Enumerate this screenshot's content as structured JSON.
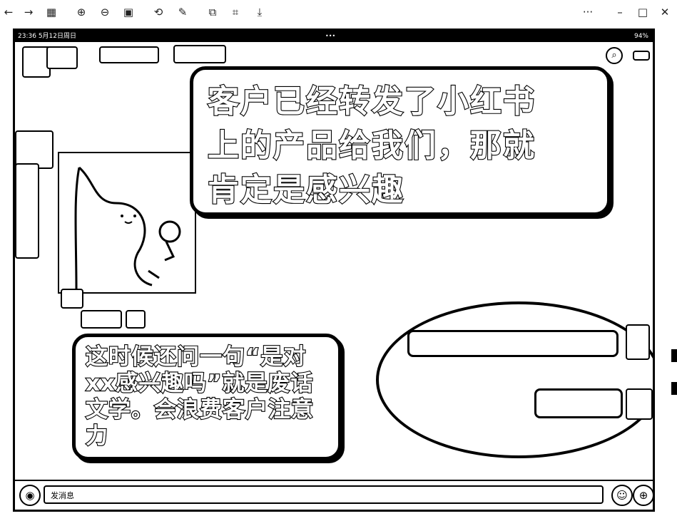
{
  "toolbar": {
    "back_icon": "←",
    "forward_icon": "→",
    "grid_icon": "▦",
    "zoom_in_icon": "⊕",
    "zoom_out_icon": "⊖",
    "fit_icon": "▣",
    "rotate_icon": "⟲",
    "edit_icon": "✎",
    "copy_icon": "⧉",
    "crop_icon": "⌗",
    "download_icon": "⤓",
    "more_icon": "···",
    "minimize_icon": "–",
    "maximize_icon": "□",
    "close_icon": "✕"
  },
  "statusbar": {
    "time": "23:36",
    "date": "5月12日周日",
    "dots": "•••",
    "battery": "94%"
  },
  "bubble_top": {
    "line1": "客户已经转发了小红书",
    "line2": "上的产品给我们，那就",
    "line3": "肯定是感兴趣"
  },
  "bubble_bottom": {
    "line1": "这时候还问一句“是对",
    "line2": "xx感兴趣吗”就是废话",
    "line3": "文学。会浪费客户注意",
    "line4": "力"
  },
  "chat": {
    "input_placeholder": "发消息",
    "voice_icon": "◉",
    "emoji_icon": "☺",
    "plus_icon": "⊕"
  },
  "header_icons": {
    "search_icon": "⌕",
    "menu_icon": "▭"
  }
}
